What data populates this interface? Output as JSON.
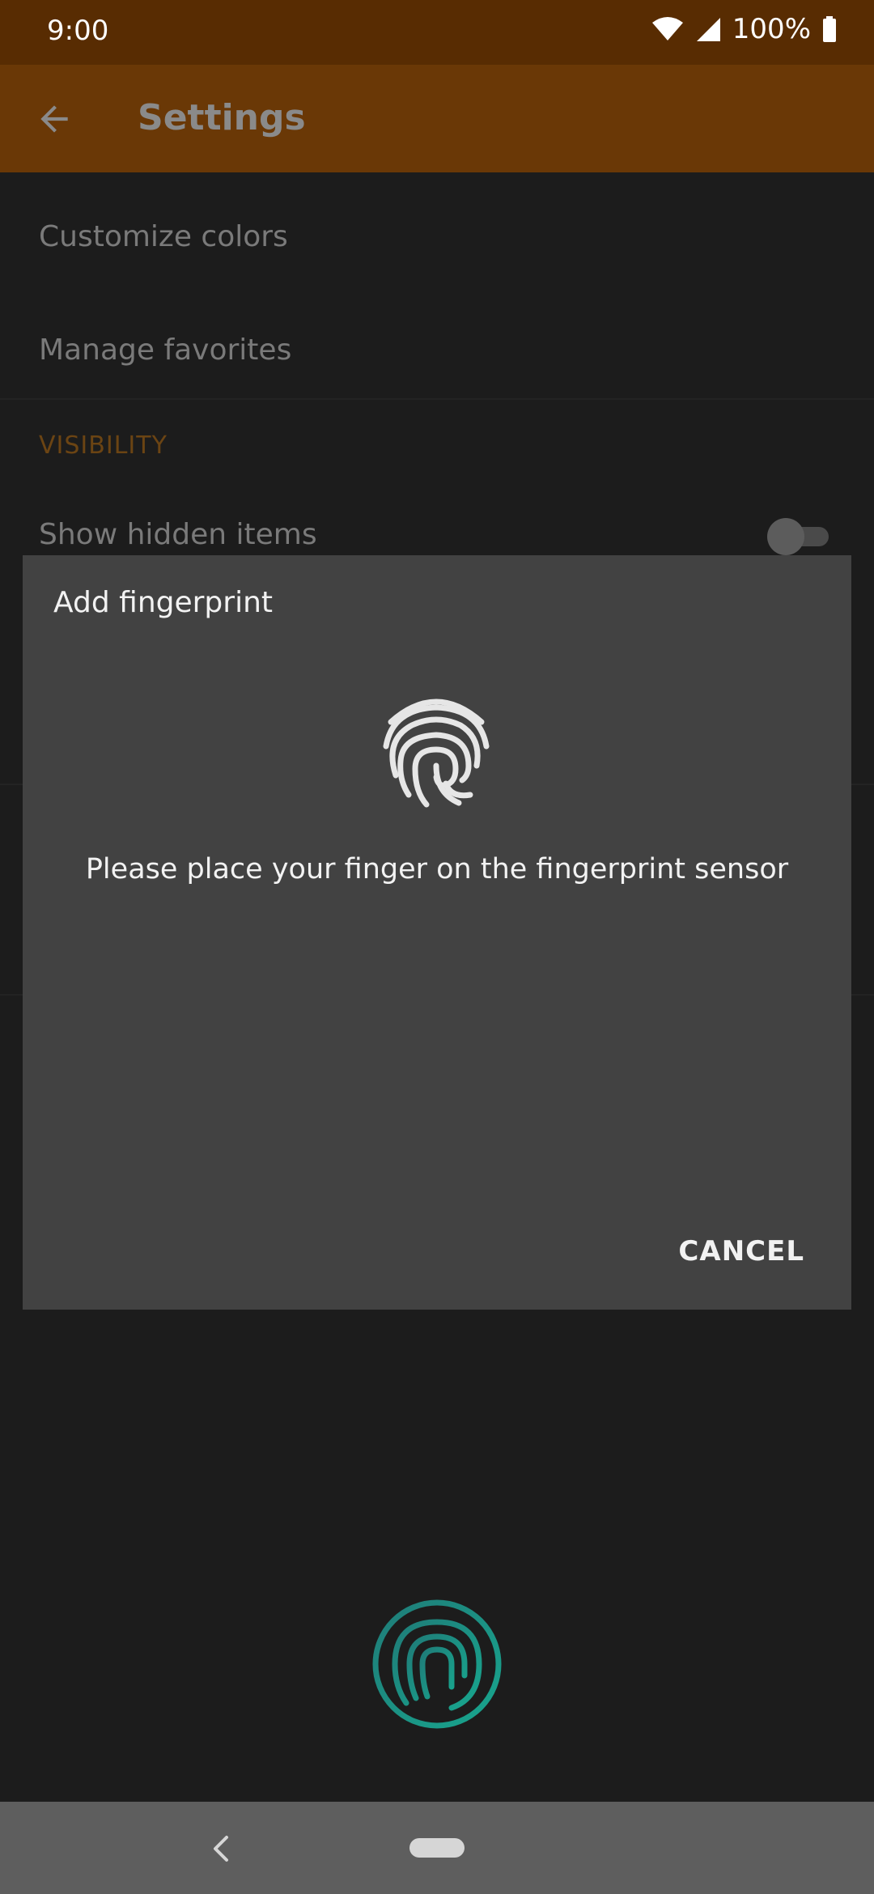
{
  "status_bar": {
    "time": "9:00",
    "battery": "100%"
  },
  "app_bar": {
    "title": "Settings"
  },
  "settings": {
    "items": [
      {
        "label": "Customize colors"
      },
      {
        "label": "Manage favorites"
      }
    ],
    "section_header": "VISIBILITY",
    "show_hidden_label": "Show hidden items",
    "show_hidden_enabled": false
  },
  "dialog": {
    "title": "Add fingerprint",
    "message": "Please place your finger on the fingerprint sensor",
    "cancel_label": "CANCEL"
  },
  "colors": {
    "status_bar": "#582c02",
    "app_bar": "#6a3806",
    "background": "#1c1c1c",
    "dialog": "#424242",
    "sensor_accent": "#1a9c8a",
    "nav_bar": "#5e5e5e"
  },
  "icons": {
    "back": "arrow-back-icon",
    "dialog_fingerprint": "fingerprint-icon",
    "sensor": "fingerprint-sensor-icon"
  }
}
